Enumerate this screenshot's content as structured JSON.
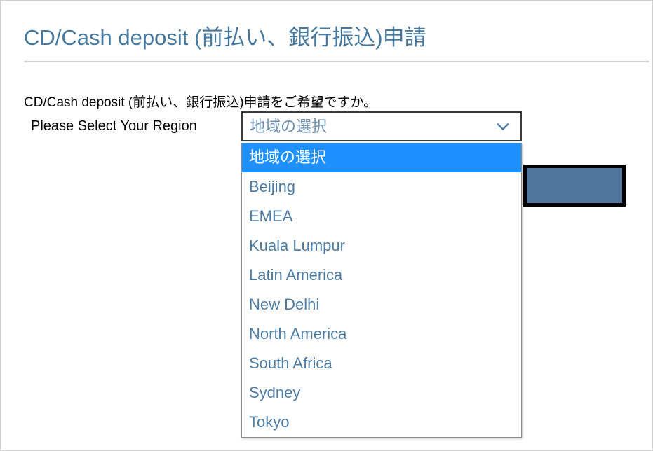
{
  "header": {
    "title": "CD/Cash deposit (前払い、銀行振込)申請"
  },
  "main": {
    "intro_text": "CD/Cash deposit (前払い、銀行振込)申請をご希望ですか。",
    "region_label": "Please Select Your Region",
    "submit_button_label": ""
  },
  "region_select": {
    "selected_value": "地域の選択",
    "chevron_icon": "chevron-down-icon",
    "expanded": true,
    "options": [
      "地域の選択",
      "Beijing",
      "EMEA",
      "Kuala Lumpur",
      "Latin America",
      "New Delhi",
      "North America",
      "South Africa",
      "Sydney",
      "Tokyo"
    ],
    "highlighted_index": 0
  },
  "colors": {
    "title_blue": "#47799f",
    "option_text_blue": "#4d7da6",
    "highlight_blue": "#1e90ff",
    "button_fill": "#52769d",
    "button_border": "#000000",
    "divider_gray": "#d2d2d2",
    "page_border": "#cfcfcf"
  }
}
